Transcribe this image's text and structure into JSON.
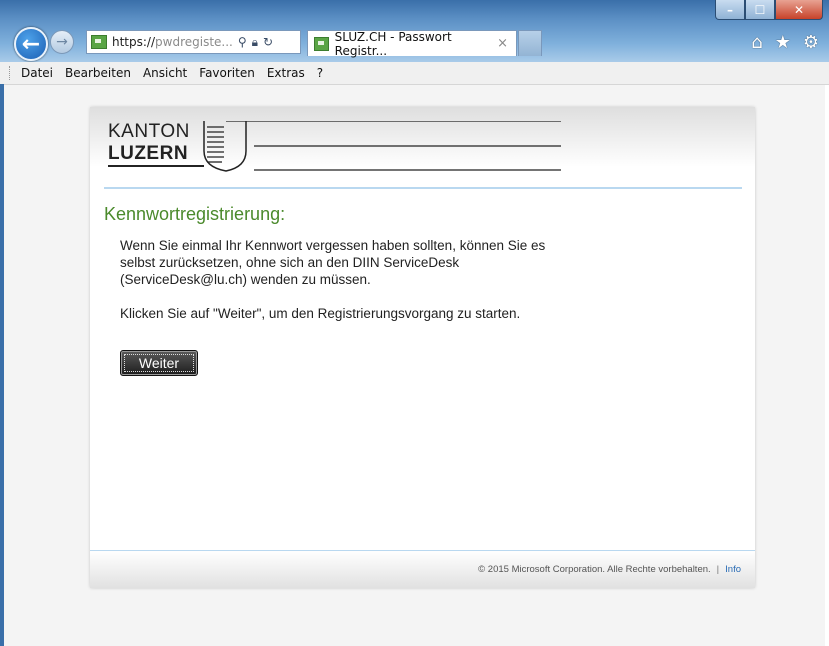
{
  "browser": {
    "address_https": "https://",
    "address_rest": "pwdregiste...",
    "tab_title": "SLUZ.CH - Passwort Registr...",
    "tab_close": "×"
  },
  "menu": [
    "Datei",
    "Bearbeiten",
    "Ansicht",
    "Favoriten",
    "Extras",
    "?"
  ],
  "logo": {
    "line1": "KANTON",
    "line2": "LUZERN"
  },
  "page": {
    "heading": "Kennwortregistrierung:",
    "paragraph1": "Wenn Sie einmal Ihr Kennwort vergessen haben sollten, können Sie es selbst zurücksetzen, ohne sich an den DIIN ServiceDesk (ServiceDesk@lu.ch) wenden zu müssen.",
    "paragraph2": "Klicken Sie auf \"Weiter\", um den Registrierungsvorgang zu starten.",
    "button": "Weiter"
  },
  "footer": {
    "copyright": "© 2015 Microsoft Corporation. Alle Rechte vorbehalten.",
    "pipe": "|",
    "info": "Info"
  },
  "colors": {
    "heading": "#4b8a2c",
    "separator": "#b9d8f0",
    "button": "#1c1c1c"
  },
  "icons": [
    "back-arrow-icon",
    "forward-arrow-icon",
    "search-icon",
    "lock-icon",
    "refresh-icon",
    "home-icon",
    "favorites-star-icon",
    "settings-gear-icon",
    "minimize-icon",
    "maximize-icon",
    "close-icon"
  ]
}
